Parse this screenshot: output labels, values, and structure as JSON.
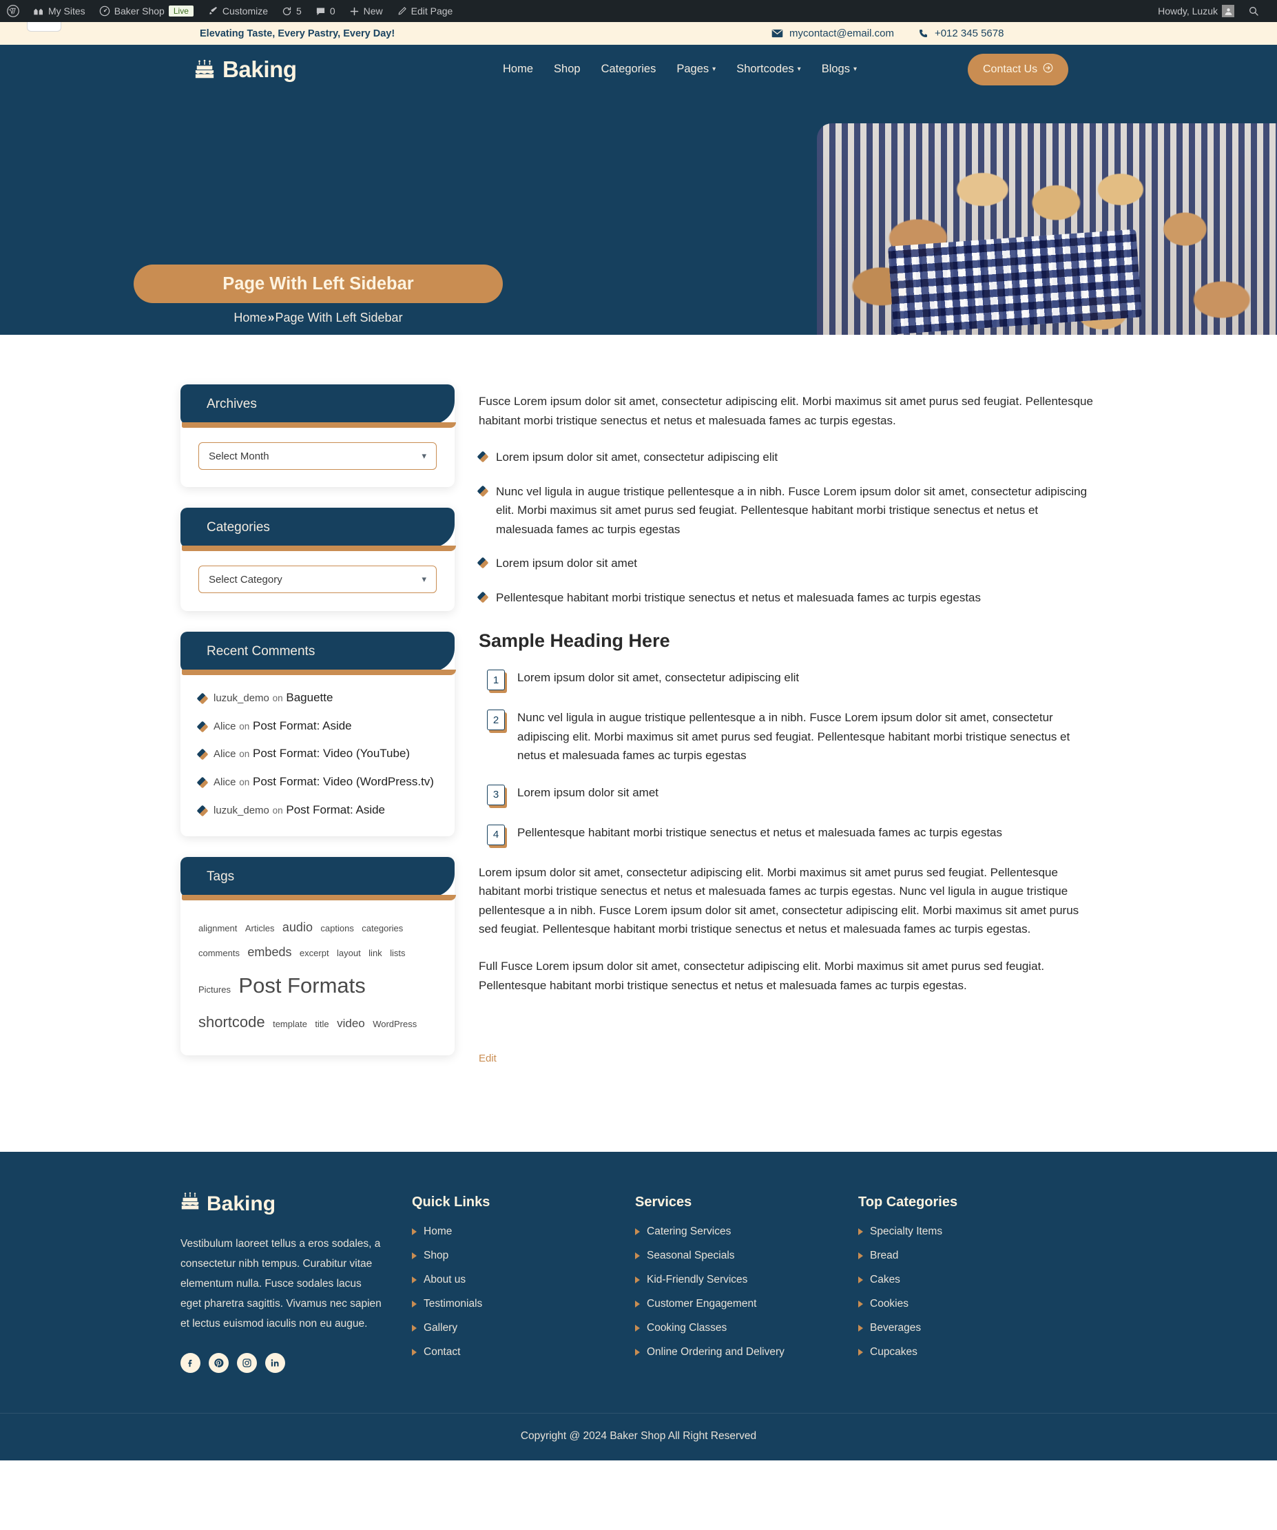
{
  "admin_bar": {
    "left_items": [
      {
        "icon": "wordpress-icon",
        "label": ""
      },
      {
        "icon": "my-sites-icon",
        "label": "My Sites"
      },
      {
        "icon": "dashboard-icon",
        "label": "Baker Shop",
        "badge": "Live"
      },
      {
        "icon": "brush-icon",
        "label": "Customize"
      },
      {
        "icon": "updates-icon",
        "label": "5"
      },
      {
        "icon": "comment-icon",
        "label": "0"
      },
      {
        "icon": "plus-icon",
        "label": "New"
      },
      {
        "icon": "pencil-icon",
        "label": "Edit Page"
      }
    ],
    "howdy": "Howdy, Luzuk",
    "search_icon": "search-icon"
  },
  "topbar": {
    "tagline": "Elevating Taste, Every Pastry, Every Day!",
    "email": "mycontact@email.com",
    "phone": "+012 345 5678"
  },
  "header": {
    "brand": "Baking",
    "nav": [
      {
        "label": "Home",
        "has_caret": false
      },
      {
        "label": "Shop",
        "has_caret": false
      },
      {
        "label": "Categories",
        "has_caret": false
      },
      {
        "label": "Pages",
        "has_caret": true
      },
      {
        "label": "Shortcodes",
        "has_caret": true
      },
      {
        "label": "Blogs",
        "has_caret": true
      }
    ],
    "cta_label": "Contact Us"
  },
  "hero": {
    "title": "Page With Left Sidebar",
    "crumb_home": "Home",
    "crumb_sep": "»",
    "crumb_current": "Page With Left Sidebar",
    "image_alt": "bread-basket-photo"
  },
  "sidebar": {
    "archives": {
      "title": "Archives",
      "select_value": "Select Month"
    },
    "categories": {
      "title": "Categories",
      "select_value": "Select Category"
    },
    "recent_comments": {
      "title": "Recent Comments",
      "items": [
        {
          "author": "luzuk_demo",
          "on": "on",
          "post": "Baguette"
        },
        {
          "author": "Alice",
          "on": "on",
          "post": "Post Format: Aside"
        },
        {
          "author": "Alice",
          "on": "on",
          "post": "Post Format: Video (YouTube)"
        },
        {
          "author": "Alice",
          "on": "on",
          "post": "Post Format: Video (WordPress.tv)"
        },
        {
          "author": "luzuk_demo",
          "on": "on",
          "post": "Post Format: Aside"
        }
      ]
    },
    "tags": {
      "title": "Tags",
      "items": [
        {
          "label": "alignment",
          "size": 13
        },
        {
          "label": "Articles",
          "size": 13
        },
        {
          "label": "audio",
          "size": 18
        },
        {
          "label": "captions",
          "size": 13
        },
        {
          "label": "categories",
          "size": 13
        },
        {
          "label": "comments",
          "size": 13
        },
        {
          "label": "embeds",
          "size": 18
        },
        {
          "label": "excerpt",
          "size": 13
        },
        {
          "label": "layout",
          "size": 13
        },
        {
          "label": "link",
          "size": 13
        },
        {
          "label": "lists",
          "size": 13
        },
        {
          "label": "Pictures",
          "size": 13
        },
        {
          "label": "Post Formats",
          "size": 31
        },
        {
          "label": "shortcode",
          "size": 22
        },
        {
          "label": "template",
          "size": 13
        },
        {
          "label": "title",
          "size": 13
        },
        {
          "label": "video",
          "size": 17
        },
        {
          "label": "WordPress",
          "size": 13
        }
      ]
    }
  },
  "content": {
    "intro": "Fusce Lorem ipsum dolor sit amet, consectetur adipiscing elit. Morbi maximus sit amet purus sed feugiat. Pellentesque habitant morbi tristique senectus et netus et malesuada fames ac turpis egestas.",
    "bullets": [
      "Lorem ipsum dolor sit amet, consectetur adipiscing elit",
      "Nunc vel ligula in augue tristique pellentesque a in nibh. Fusce Lorem ipsum dolor sit amet, consectetur adipiscing elit. Morbi maximus sit amet purus sed feugiat. Pellentesque habitant morbi tristique senectus et netus et malesuada fames ac turpis egestas",
      "Lorem ipsum dolor sit amet",
      "Pellentesque habitant morbi tristique senectus et netus et malesuada fames ac turpis egestas"
    ],
    "heading": "Sample Heading Here",
    "numbered": [
      {
        "num": "1",
        "text": "Lorem ipsum dolor sit amet, consectetur adipiscing elit"
      },
      {
        "num": "2",
        "text": "Nunc vel ligula in augue tristique pellentesque a in nibh. Fusce Lorem ipsum dolor sit amet, consectetur adipiscing elit. Morbi maximus sit amet purus sed feugiat. Pellentesque habitant morbi tristique senectus et netus et malesuada fames ac turpis egestas"
      },
      {
        "num": "3",
        "text": "Lorem ipsum dolor sit amet"
      },
      {
        "num": "4",
        "text": "Pellentesque habitant morbi tristique senectus et netus et malesuada fames ac turpis egestas"
      }
    ],
    "para_2": "Lorem ipsum dolor sit amet, consectetur adipiscing elit. Morbi maximus sit amet purus sed feugiat. Pellentesque habitant morbi tristique senectus et netus et malesuada fames ac turpis egestas. Nunc vel ligula in augue tristique pellentesque a in nibh. Fusce Lorem ipsum dolor sit amet, consectetur adipiscing elit. Morbi maximus sit amet purus sed feugiat. Pellentesque habitant morbi tristique senectus et netus et malesuada fames ac turpis egestas.",
    "para_3": "Full Fusce Lorem ipsum dolor sit amet, consectetur adipiscing elit. Morbi maximus sit amet purus sed feugiat. Pellentesque habitant morbi tristique senectus et netus et malesuada fames ac turpis egestas.",
    "edit_link": "Edit"
  },
  "footer": {
    "brand": "Baking",
    "about": "Vestibulum laoreet tellus a eros sodales, a consectetur nibh tempus. Curabitur vitae elementum nulla. Fusce sodales lacus eget pharetra sagittis. Vivamus nec sapien et lectus euismod iaculis non eu augue.",
    "socials": [
      {
        "name": "facebook-icon"
      },
      {
        "name": "pinterest-icon"
      },
      {
        "name": "instagram-icon"
      },
      {
        "name": "linkedin-icon"
      }
    ],
    "columns": [
      {
        "title": "Quick Links",
        "links": [
          "Home",
          "Shop",
          "About us",
          "Testimonials",
          "Gallery",
          "Contact"
        ]
      },
      {
        "title": "Services",
        "links": [
          "Catering Services",
          "Seasonal Specials",
          "Kid-Friendly Services",
          "Customer Engagement",
          "Cooking Classes",
          "Online Ordering and Delivery"
        ]
      },
      {
        "title": "Top Categories",
        "links": [
          "Specialty Items",
          "Bread",
          "Cakes",
          "Cookies",
          "Beverages",
          "Cupcakes"
        ]
      }
    ],
    "copyright": "Copyright @ 2024 Baker Shop All Right Reserved"
  },
  "colors": {
    "navy": "#16405e",
    "gold": "#c98d52",
    "cream": "#fdf3e0",
    "admin_dark": "#1d2327"
  }
}
